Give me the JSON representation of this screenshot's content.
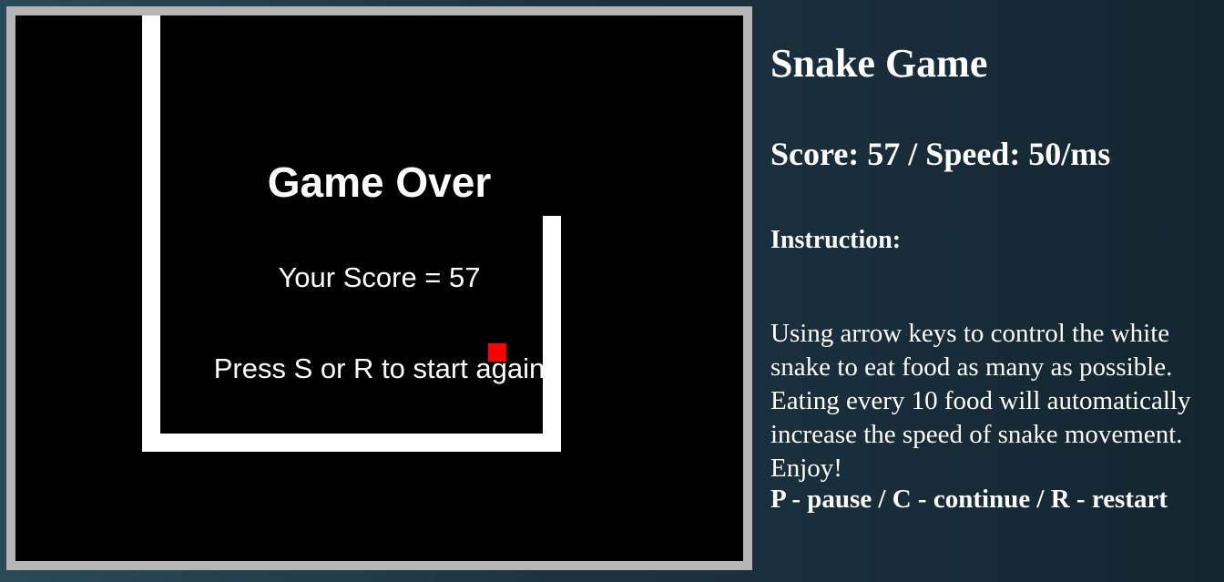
{
  "board": {
    "game_over_title": "Game Over",
    "score_text": "Your Score = 57",
    "restart_text": "Press S or R to start again",
    "snake_color": "#ffffff",
    "food_color": "#ff0000",
    "background_color": "#000000"
  },
  "sidebar": {
    "title": "Snake Game",
    "status": "Score: 57 / Speed: 50/ms",
    "instruction_heading": "Instruction:",
    "description_lines": [
      "Using arrow keys to control the white",
      "snake to eat food as many as possible.",
      "Eating every 10 food will automatically",
      "increase the speed of snake movement.",
      "Enjoy!"
    ],
    "keys": "P - pause / C - continue / R - restart"
  }
}
